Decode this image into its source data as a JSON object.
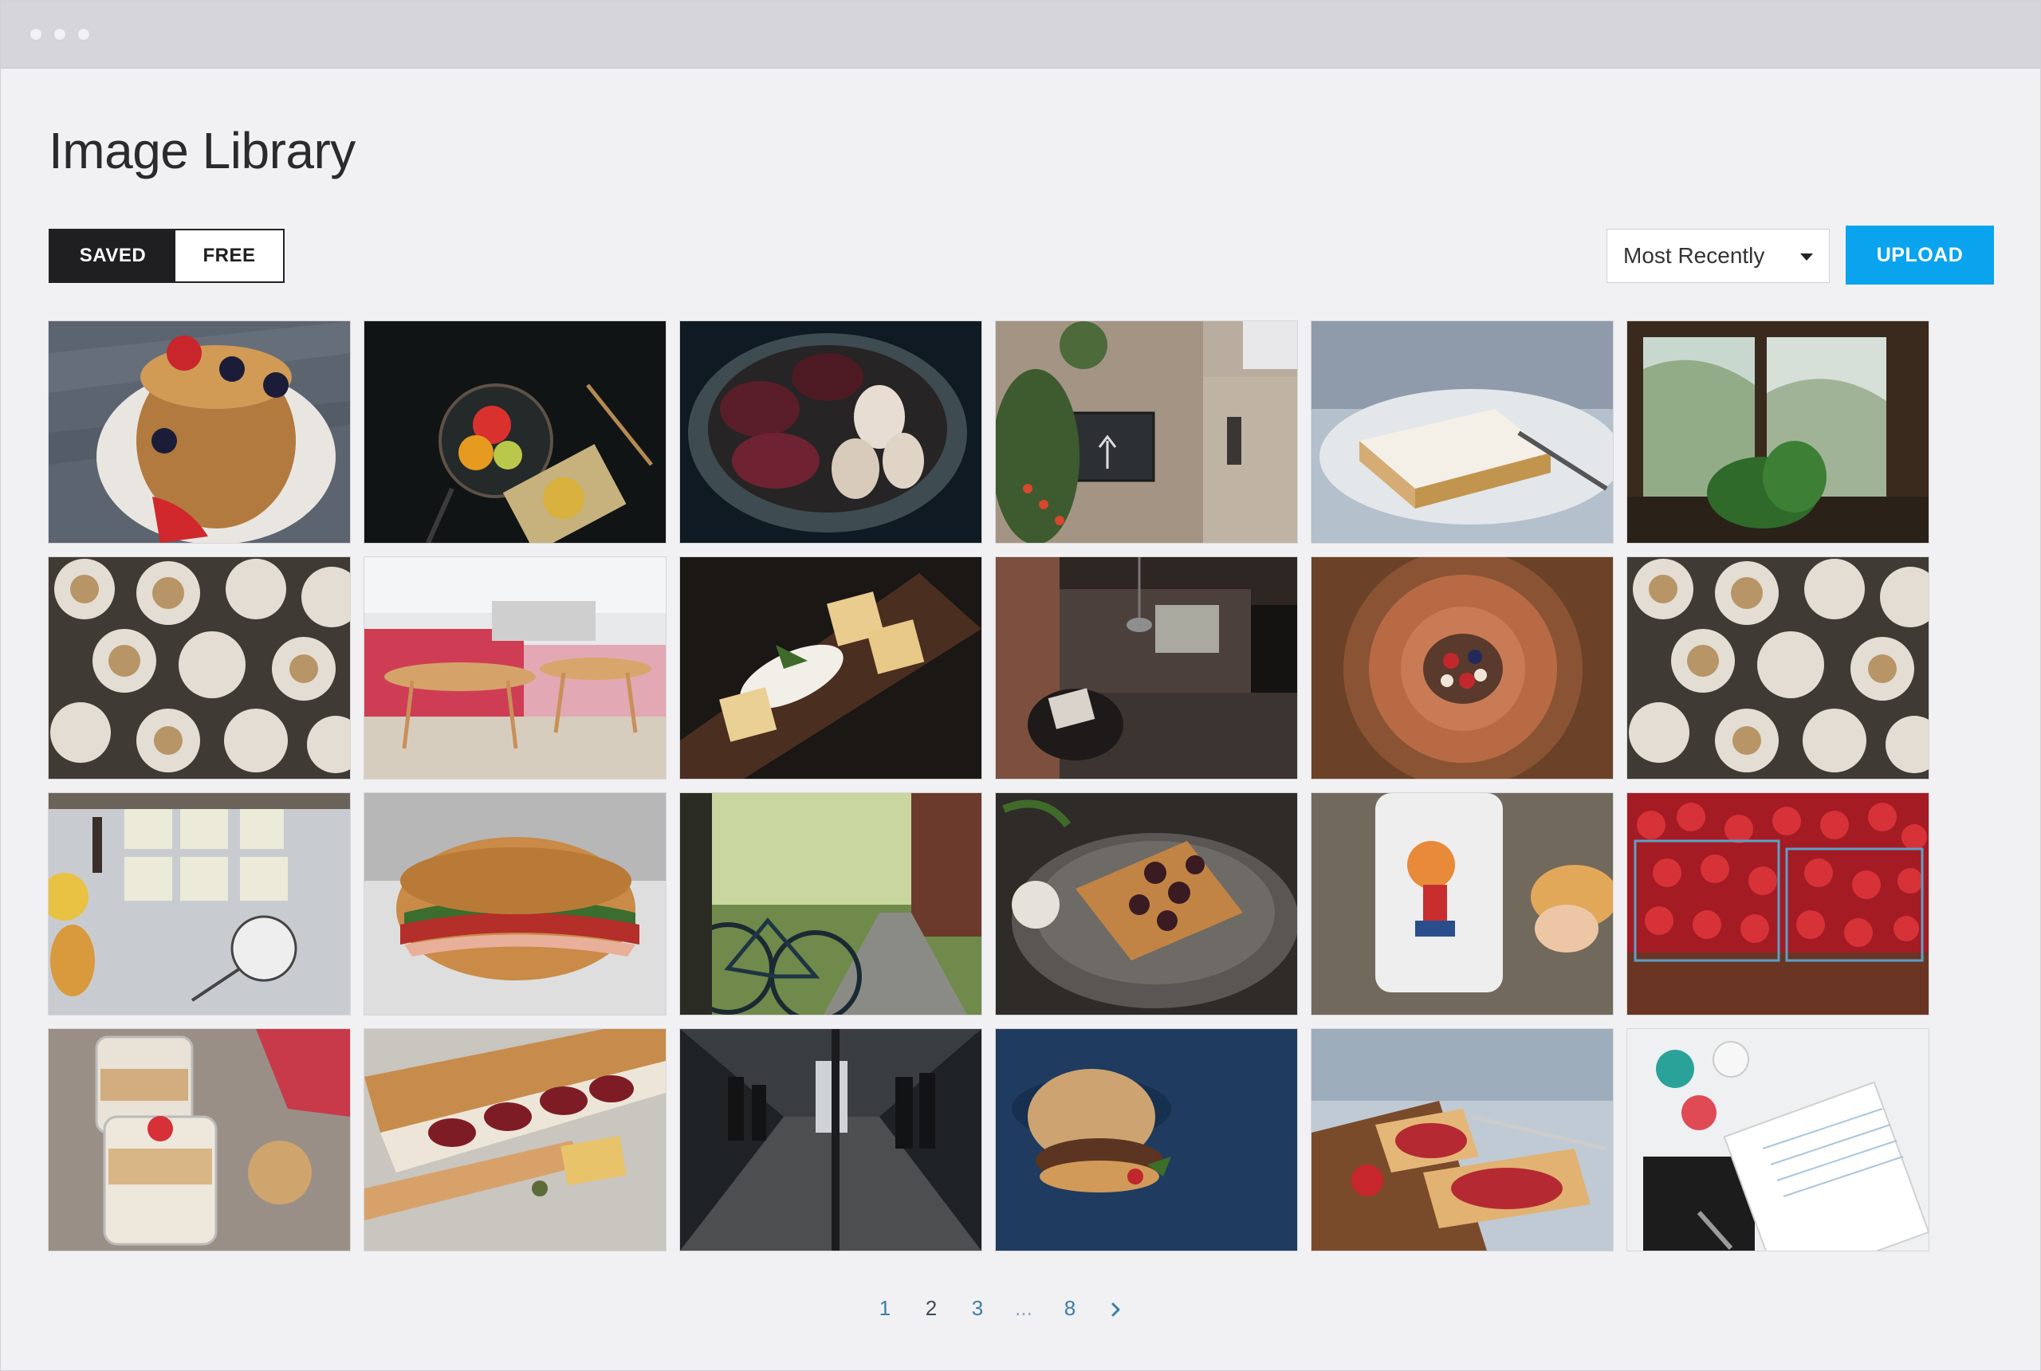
{
  "page": {
    "title": "Image Library"
  },
  "tabs": {
    "saved": "SAVED",
    "free": "FREE",
    "active": "SAVED"
  },
  "sort": {
    "selected": "Most Recently"
  },
  "toolbar": {
    "upload_label": "UPLOAD"
  },
  "colors": {
    "accent": "#0aa4ee",
    "toggle_active": "#1f1f21",
    "link": "#3b7fa8"
  },
  "gallery": {
    "images": [
      {
        "subject": "pancakes-with-berries"
      },
      {
        "subject": "lemons-on-dark-table"
      },
      {
        "subject": "beets-and-garlic-bowl"
      },
      {
        "subject": "hotel-restaurant-sign"
      },
      {
        "subject": "slice-of-cream-pie"
      },
      {
        "subject": "window-with-plant"
      },
      {
        "subject": "meringue-cupcakes"
      },
      {
        "subject": "pink-sofa-lounge"
      },
      {
        "subject": "cheese-and-crackers"
      },
      {
        "subject": "loft-interior"
      },
      {
        "subject": "pancakes-on-plate"
      },
      {
        "subject": "meringue-cupcakes"
      },
      {
        "subject": "baking-ingredients"
      },
      {
        "subject": "sandwich"
      },
      {
        "subject": "bicycle-on-path"
      },
      {
        "subject": "waffles-with-berries"
      },
      {
        "subject": "mug-and-pastry"
      },
      {
        "subject": "strawberry-baskets"
      },
      {
        "subject": "yogurt-parfaits"
      },
      {
        "subject": "baguette-with-salami"
      },
      {
        "subject": "subway-station"
      },
      {
        "subject": "burger-on-blue"
      },
      {
        "subject": "toast-with-jam"
      },
      {
        "subject": "notebook-and-pins"
      }
    ]
  },
  "pagination": {
    "pages": [
      "1",
      "2",
      "3",
      "...",
      "8"
    ],
    "current": "2",
    "next_icon": "chevron-right-icon"
  }
}
